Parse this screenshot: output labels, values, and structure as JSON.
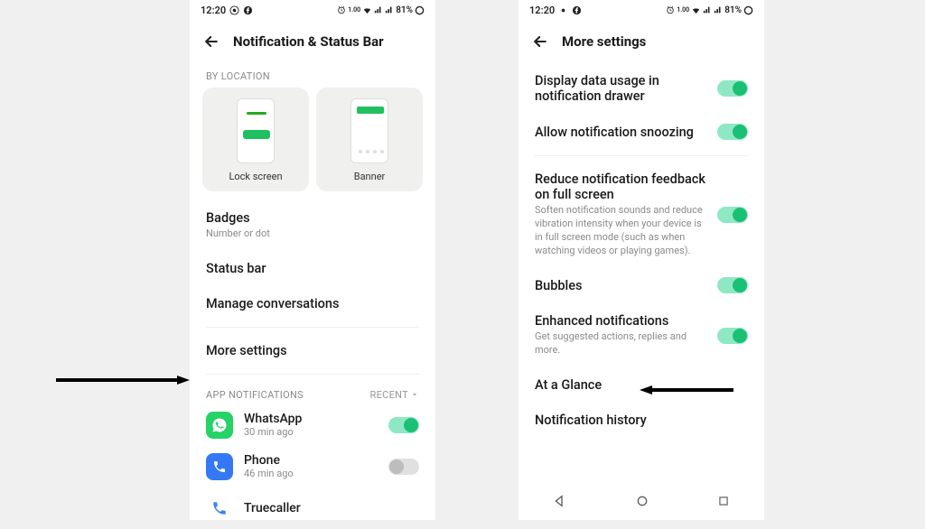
{
  "status": {
    "time": "12:20",
    "battery": "81%",
    "alarm": "1.00"
  },
  "left": {
    "title": "Notification & Status Bar",
    "byLocation": "BY LOCATION",
    "cards": {
      "lock": "Lock screen",
      "banner": "Banner"
    },
    "badges": {
      "title": "Badges",
      "sub": "Number or dot"
    },
    "statusBar": "Status bar",
    "manageConversations": "Manage conversations",
    "moreSettings": "More settings",
    "appNotifications": "APP NOTIFICATIONS",
    "recent": "RECENT",
    "apps": [
      {
        "name": "WhatsApp",
        "time": "30 min ago",
        "toggle": true
      },
      {
        "name": "Phone",
        "time": "46 min ago",
        "toggle": false
      },
      {
        "name": "Truecaller",
        "time": "",
        "toggle": true
      }
    ]
  },
  "right": {
    "title": "More settings",
    "rows": {
      "dataUsage": "Display data usage in notification drawer",
      "snoozing": "Allow notification snoozing",
      "reduceTitle": "Reduce notification feedback on full screen",
      "reduceSub": "Soften notification sounds and reduce vibration intensity when your device is in full screen mode (such as when watching videos or playing games).",
      "bubbles": "Bubbles",
      "enhancedTitle": "Enhanced notifications",
      "enhancedSub": "Get suggested actions, replies and more.",
      "glance": "At a Glance",
      "history": "Notification history"
    }
  }
}
